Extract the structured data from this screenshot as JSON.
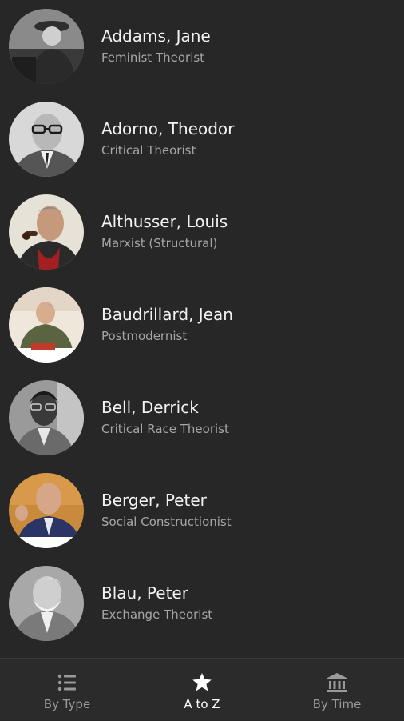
{
  "theorists": [
    {
      "name": "Addams, Jane",
      "type": "Feminist Theorist"
    },
    {
      "name": "Adorno, Theodor",
      "type": "Critical Theorist"
    },
    {
      "name": "Althusser, Louis",
      "type": "Marxist (Structural)"
    },
    {
      "name": "Baudrillard, Jean",
      "type": "Postmodernist"
    },
    {
      "name": "Bell, Derrick",
      "type": "Critical Race Theorist"
    },
    {
      "name": "Berger, Peter",
      "type": "Social Constructionist"
    },
    {
      "name": "Blau, Peter",
      "type": "Exchange Theorist"
    }
  ],
  "bottom_nav": {
    "items": [
      {
        "label": "By Type",
        "icon": "list-icon",
        "active": false
      },
      {
        "label": "A to Z",
        "icon": "star-icon",
        "active": true
      },
      {
        "label": "By Time",
        "icon": "museum-icon",
        "active": false
      }
    ]
  },
  "colors": {
    "background": "#272727",
    "nav_background": "#2b2b2b",
    "active_label": "#ffffff",
    "inactive_label": "#9a9a9a",
    "subtitle": "#a6a6a6"
  }
}
